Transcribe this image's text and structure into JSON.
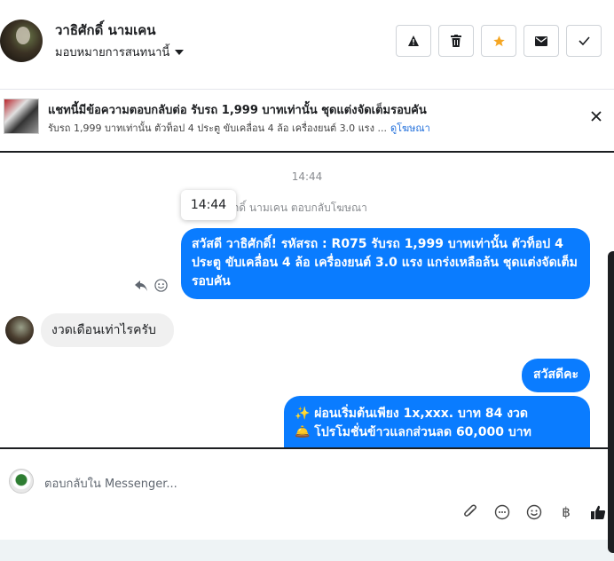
{
  "header": {
    "user_name": "วาธิศักดิ์ นามเคน",
    "assign_label": "มอบหมายการสนทนานี้",
    "actions": [
      "warning-icon",
      "trash-icon",
      "star-icon",
      "mail-icon",
      "check-icon"
    ],
    "star_color": "#f5a623"
  },
  "ad": {
    "title": "แชทนี้มีข้อความตอบกลับต่อ รับรถ 1,999 บาทเท่านั้น ชุดแต่งจัดเต็มรอบคัน",
    "subtitle": "รับรถ 1,999 บาทเท่านั้น ตัวท็อป 4 ประตู ขับเคลื่อน 4 ล้อ เครื่องยนต์ 3.0 แรง ...",
    "link": "ดูโฆษณา"
  },
  "chat": {
    "time_center": "14:44",
    "tooltip_time": "14:44",
    "replied_note": "กดิ์ นามเคน ตอบกลับโฆษณา",
    "messages": [
      {
        "text": "สวัสดี วาธิศักดิ์! รหัสรถ : R075 รับรถ 1,999 บาทเท่านั้น ตัวท็อป 4 ประตู ขับเคลื่อน 4 ล้อ  เครื่องยนต์ 3.0 แรง แกร่งเหลือล้น ชุดแต่งจัดเต็มรอบคัน"
      },
      {
        "text": "งวดเดือนเท่าไรครับ"
      },
      {
        "text": "สวัสดีคะ"
      },
      {
        "line1": "✨  ผ่อนเริ่มต้นเพียง 1x,xxx. บาท 84 งวด",
        "line2": "🛎️ โปรโมชั่นข้าวแลกส่วนลด 60,000 บาท",
        "line3": ""
      }
    ],
    "accent": "#0a7cff"
  },
  "composer": {
    "placeholder": "ตอบกลับใน Messenger...",
    "icons": [
      "attach-icon",
      "chat-icon",
      "emoji-icon",
      "baht-icon",
      "thumbs-up-icon"
    ],
    "baht_symbol": "฿"
  }
}
